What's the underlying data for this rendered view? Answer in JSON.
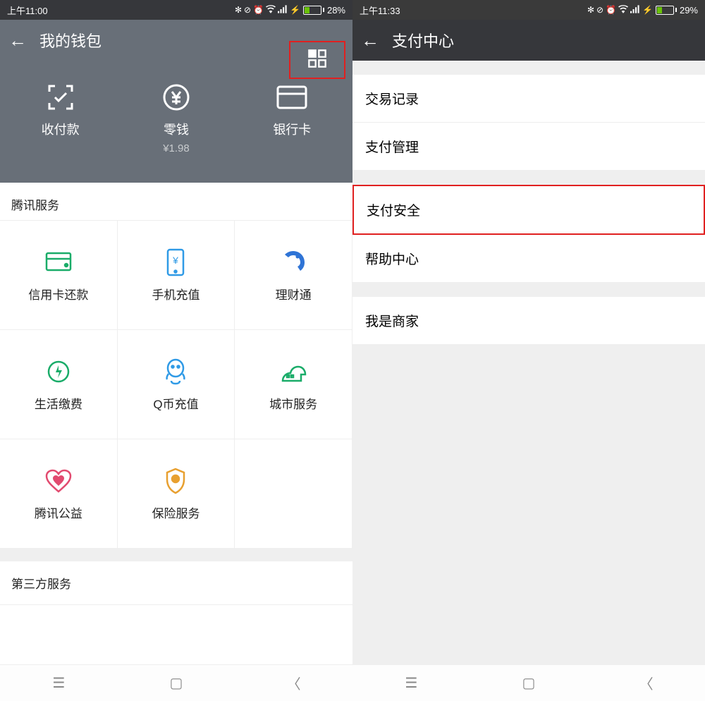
{
  "left": {
    "status": {
      "time": "上午11:00",
      "battery_pct": "28%"
    },
    "title": "我的钱包",
    "actions": {
      "pay": {
        "label": "收付款"
      },
      "change": {
        "label": "零钱",
        "amount": "¥1.98"
      },
      "cards": {
        "label": "银行卡"
      }
    },
    "tencent_section": "腾讯服务",
    "services": [
      {
        "label": "信用卡还款"
      },
      {
        "label": "手机充值"
      },
      {
        "label": "理财通"
      },
      {
        "label": "生活缴费"
      },
      {
        "label": "Q币充值"
      },
      {
        "label": "城市服务"
      },
      {
        "label": "腾讯公益"
      },
      {
        "label": "保险服务"
      }
    ],
    "third_party_section": "第三方服务"
  },
  "right": {
    "status": {
      "time": "上午11:33",
      "battery_pct": "29%"
    },
    "title": "支付中心",
    "rows": {
      "tx": "交易记录",
      "mgmt": "支付管理",
      "security": "支付安全",
      "help": "帮助中心",
      "merchant": "我是商家"
    }
  }
}
